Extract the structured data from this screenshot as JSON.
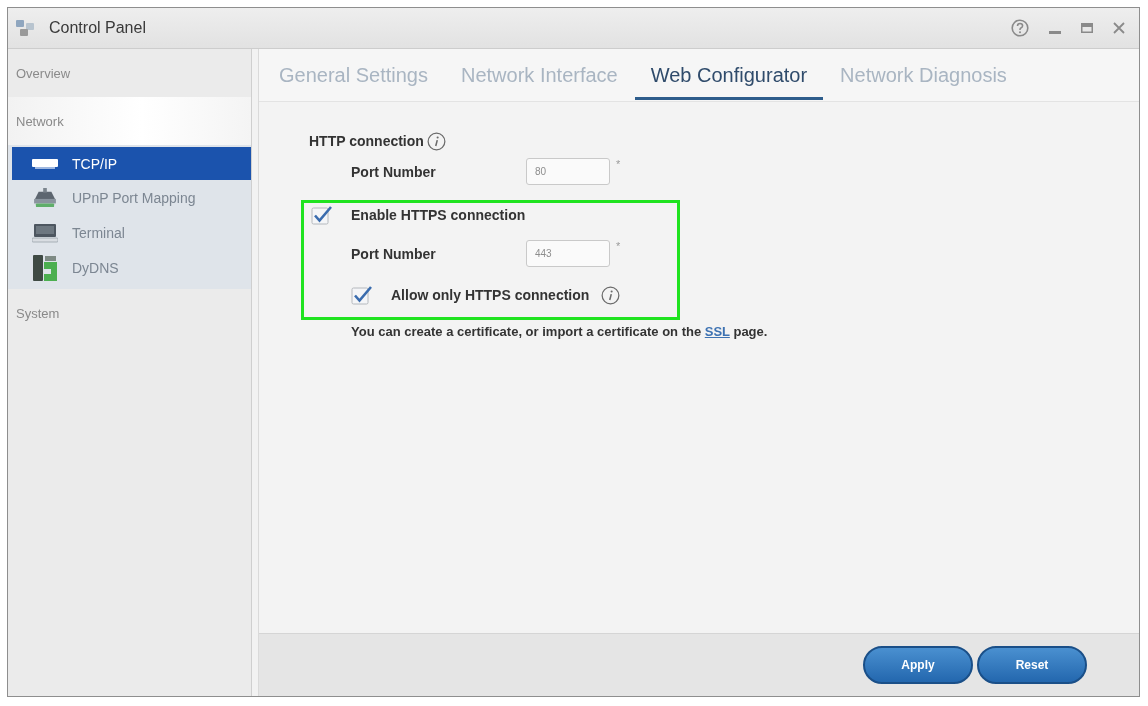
{
  "window": {
    "title": "Control Panel"
  },
  "sidebar": {
    "items": [
      {
        "label": "Overview",
        "selected": false,
        "expanded": false
      },
      {
        "label": "Network",
        "selected": false,
        "expanded": true,
        "children": [
          {
            "label": "TCP/IP",
            "selected": true
          },
          {
            "label": "UPnP Port Mapping",
            "selected": false
          },
          {
            "label": "Terminal",
            "selected": false
          },
          {
            "label": "DyDNS",
            "selected": false
          }
        ]
      },
      {
        "label": "System",
        "selected": false,
        "expanded": false
      }
    ]
  },
  "tabs": [
    {
      "label": "General Settings",
      "selected": false
    },
    {
      "label": "Network Interface",
      "selected": false
    },
    {
      "label": "Web Configurator",
      "selected": true
    },
    {
      "label": "Network Diagnosis",
      "selected": false
    }
  ],
  "web_configurator": {
    "http": {
      "heading": "HTTP connection",
      "info": true,
      "port": {
        "label": "Port Number",
        "value": "80",
        "required_mark": "*"
      }
    },
    "https": {
      "highlighted": true,
      "enable": {
        "label": "Enable HTTPS connection",
        "checked": true
      },
      "port": {
        "label": "Port Number",
        "value": "443",
        "required_mark": "*"
      },
      "https_only": {
        "label": "Allow only HTTPS connection",
        "checked": true,
        "info": true
      }
    },
    "note": {
      "text_before": "You can create a certificate, or import a certificate on the ",
      "link": "SSL",
      "text_after": " page."
    }
  },
  "buttons": [
    "Apply",
    "Reset"
  ]
}
